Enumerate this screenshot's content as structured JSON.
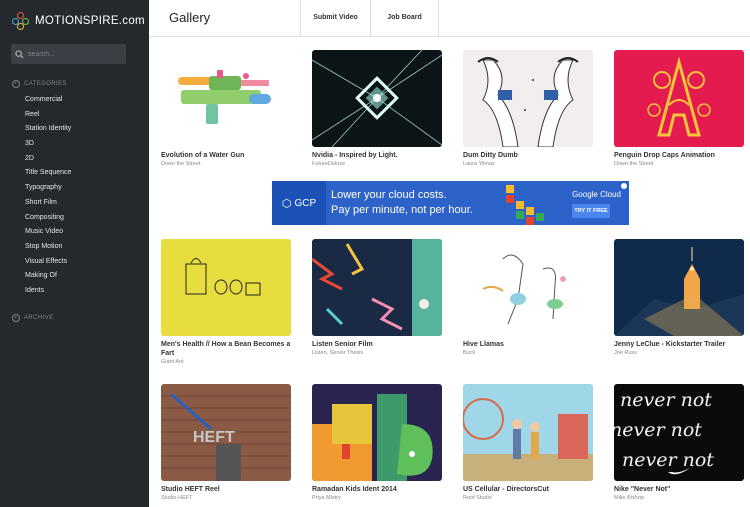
{
  "app": {
    "logo_text": "MOTIONSPIRE.com"
  },
  "search": {
    "placeholder": "search..."
  },
  "sidebar": {
    "categories_label": "CATEGORIES",
    "archive_label": "ARCHIVE",
    "categories": [
      "Commercial",
      "Reel",
      "Station Identity",
      "3D",
      "2D",
      "Title Sequence",
      "Typography",
      "Short Film",
      "Compositing",
      "Music Video",
      "Stop Motion",
      "Visual Effects",
      "Making Of",
      "Idents"
    ]
  },
  "header": {
    "title": "Gallery",
    "tabs": [
      "Submit Video",
      "Job Board"
    ]
  },
  "ad": {
    "brand_short": "GCP",
    "line1": "Lower your cloud costs.",
    "line2": "Pay per minute, not per hour.",
    "brand": "Google Cloud",
    "cta": "TRY IT FREE"
  },
  "gallery": [
    {
      "title": "Evolution of a Water Gun",
      "author": "Down the Street"
    },
    {
      "title": "Nvidia - Inspired by Light.",
      "author": "FutureDeluxe"
    },
    {
      "title": "Dum Ditty Dumb",
      "author": "Laura Yilmaz"
    },
    {
      "title": "Penguin Drop Caps Animation",
      "author": "Down the Street"
    },
    {
      "title": "Men's Health // How a Bean Becomes a Fart",
      "author": "Giant Ant"
    },
    {
      "title": "Listen Senior Film",
      "author": "Listen, Senior Thesis"
    },
    {
      "title": "Hive Llamas",
      "author": "Buck"
    },
    {
      "title": "Jenny LeClue - Kickstarter Trailer",
      "author": "Joe Russ"
    },
    {
      "title": "Studio HEFT Reel",
      "author": "Studio HEFT"
    },
    {
      "title": "Ramadan Kids Ident 2014",
      "author": "Priya Mistry"
    },
    {
      "title": "US Cellular - DirectorsCut",
      "author": "Roof Studio"
    },
    {
      "title": "Nike \"Never Not\"",
      "author": "Mike Bishop"
    }
  ],
  "thumbnail_art": {
    "thumb_11_text": "never not",
    "thumb_8_text": "HEFT"
  }
}
